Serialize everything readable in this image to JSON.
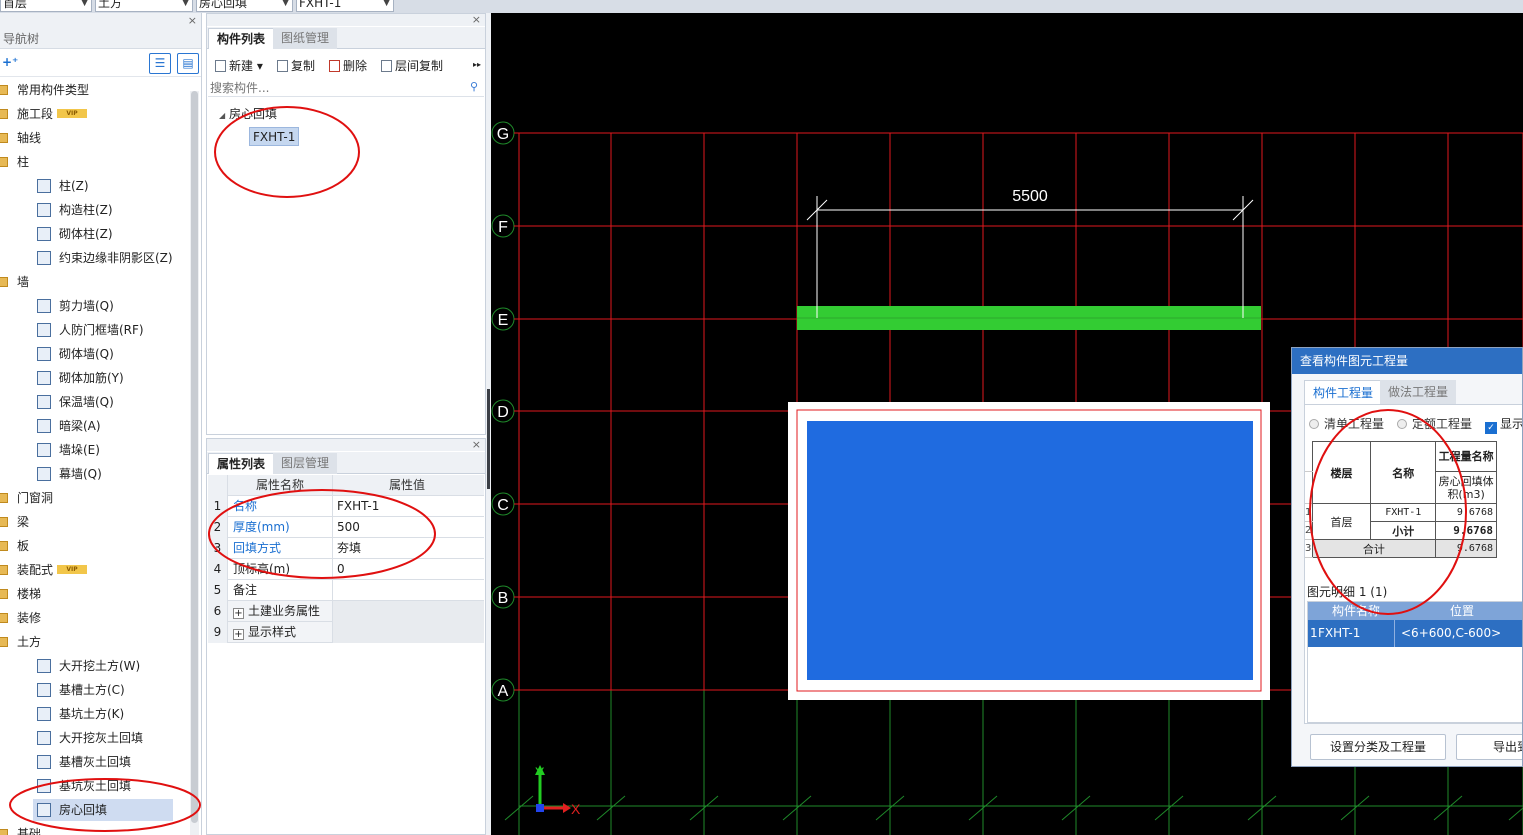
{
  "topbar": {
    "floor": "首层",
    "category": "土方",
    "type": "房心回填",
    "component": "FXHT-1"
  },
  "nav": {
    "title": "导航树",
    "close": "×",
    "add_icon": "add-icon",
    "items": [
      {
        "label": "常用构件类型",
        "kind": "cat"
      },
      {
        "label": "施工段",
        "kind": "cat",
        "badge": "VIP"
      },
      {
        "label": "轴线",
        "kind": "cat"
      },
      {
        "label": "柱",
        "kind": "cat"
      },
      {
        "label": "柱(Z)",
        "kind": "leaf"
      },
      {
        "label": "构造柱(Z)",
        "kind": "leaf"
      },
      {
        "label": "砌体柱(Z)",
        "kind": "leaf"
      },
      {
        "label": "约束边缘非阴影区(Z)",
        "kind": "leaf"
      },
      {
        "label": "墙",
        "kind": "cat"
      },
      {
        "label": "剪力墙(Q)",
        "kind": "leaf"
      },
      {
        "label": "人防门框墙(RF)",
        "kind": "leaf"
      },
      {
        "label": "砌体墙(Q)",
        "kind": "leaf"
      },
      {
        "label": "砌体加筋(Y)",
        "kind": "leaf"
      },
      {
        "label": "保温墙(Q)",
        "kind": "leaf"
      },
      {
        "label": "暗梁(A)",
        "kind": "leaf"
      },
      {
        "label": "墙垛(E)",
        "kind": "leaf"
      },
      {
        "label": "幕墙(Q)",
        "kind": "leaf"
      },
      {
        "label": "门窗洞",
        "kind": "cat"
      },
      {
        "label": "梁",
        "kind": "cat"
      },
      {
        "label": "板",
        "kind": "cat"
      },
      {
        "label": "装配式",
        "kind": "cat",
        "badge": "VIP"
      },
      {
        "label": "楼梯",
        "kind": "cat"
      },
      {
        "label": "装修",
        "kind": "cat"
      },
      {
        "label": "土方",
        "kind": "cat"
      },
      {
        "label": "大开挖土方(W)",
        "kind": "leaf"
      },
      {
        "label": "基槽土方(C)",
        "kind": "leaf"
      },
      {
        "label": "基坑土方(K)",
        "kind": "leaf"
      },
      {
        "label": "大开挖灰土回填",
        "kind": "leaf"
      },
      {
        "label": "基槽灰土回填",
        "kind": "leaf"
      },
      {
        "label": "基坑灰土回填",
        "kind": "leaf"
      },
      {
        "label": "房心回填",
        "kind": "leaf",
        "selected": true
      },
      {
        "label": "基础",
        "kind": "cat"
      }
    ]
  },
  "component_panel": {
    "tabs": [
      "构件列表",
      "图纸管理"
    ],
    "toolbar": {
      "new": "新建",
      "copy": "复制",
      "delete": "删除",
      "floor_copy": "层间复制",
      "more": "▸▸"
    },
    "search_placeholder": "搜索构件...",
    "tree_root": "房心回填",
    "tree_item": "FXHT-1"
  },
  "property_panel": {
    "tabs": [
      "属性列表",
      "图层管理"
    ],
    "header": {
      "name": "属性名称",
      "value": "属性值"
    },
    "rows": [
      {
        "num": "1",
        "name": "名称",
        "value": "FXHT-1"
      },
      {
        "num": "2",
        "name": "厚度(mm)",
        "value": "500"
      },
      {
        "num": "3",
        "name": "回填方式",
        "value": "夯填"
      },
      {
        "num": "4",
        "name": "顶标高(m)",
        "value": "0"
      },
      {
        "num": "5",
        "name": "备注",
        "value": ""
      },
      {
        "num": "6",
        "name": "土建业务属性",
        "value": ""
      },
      {
        "num": "9",
        "name": "显示样式",
        "value": ""
      }
    ]
  },
  "canvas": {
    "axis_labels": [
      "G",
      "F",
      "E",
      "D",
      "C",
      "B",
      "A"
    ],
    "dimension": "5500",
    "ucs": {
      "x": "X",
      "y": "Y"
    },
    "colors": {
      "grid": "#e0181e",
      "green_grid": "#1f8a2a",
      "beam": "#33cc33",
      "fill": "#1f6be0",
      "outline": "#ffffff",
      "annotation": "#e01010"
    }
  },
  "dialog": {
    "title": "查看构件图元工程量",
    "tabs": [
      "构件工程量",
      "做法工程量"
    ],
    "radios": [
      "清单工程量",
      "定额工程量"
    ],
    "check": "显示",
    "table": {
      "col_floor": "楼层",
      "col_name": "名称",
      "col_qty_name": "工程量名称",
      "col_qty_sub": "房心回填体积(m3)",
      "rownums": [
        "1",
        "2",
        "3"
      ],
      "floor": "首层",
      "item": "FXHT-1",
      "item_value": "9.6768",
      "subtotal_label": "小计",
      "subtotal_value": "9.6768",
      "total_label": "合计",
      "total_value": "9.6768"
    },
    "detail_label": "图元明细  1 (1)",
    "detail_head": {
      "name": "构件名称",
      "pos": "位置"
    },
    "detail_row": {
      "num": "1",
      "name": "FXHT-1",
      "pos": "<6+600,C-600>"
    },
    "buttons": {
      "classify": "设置分类及工程量",
      "export": "导出到"
    }
  }
}
